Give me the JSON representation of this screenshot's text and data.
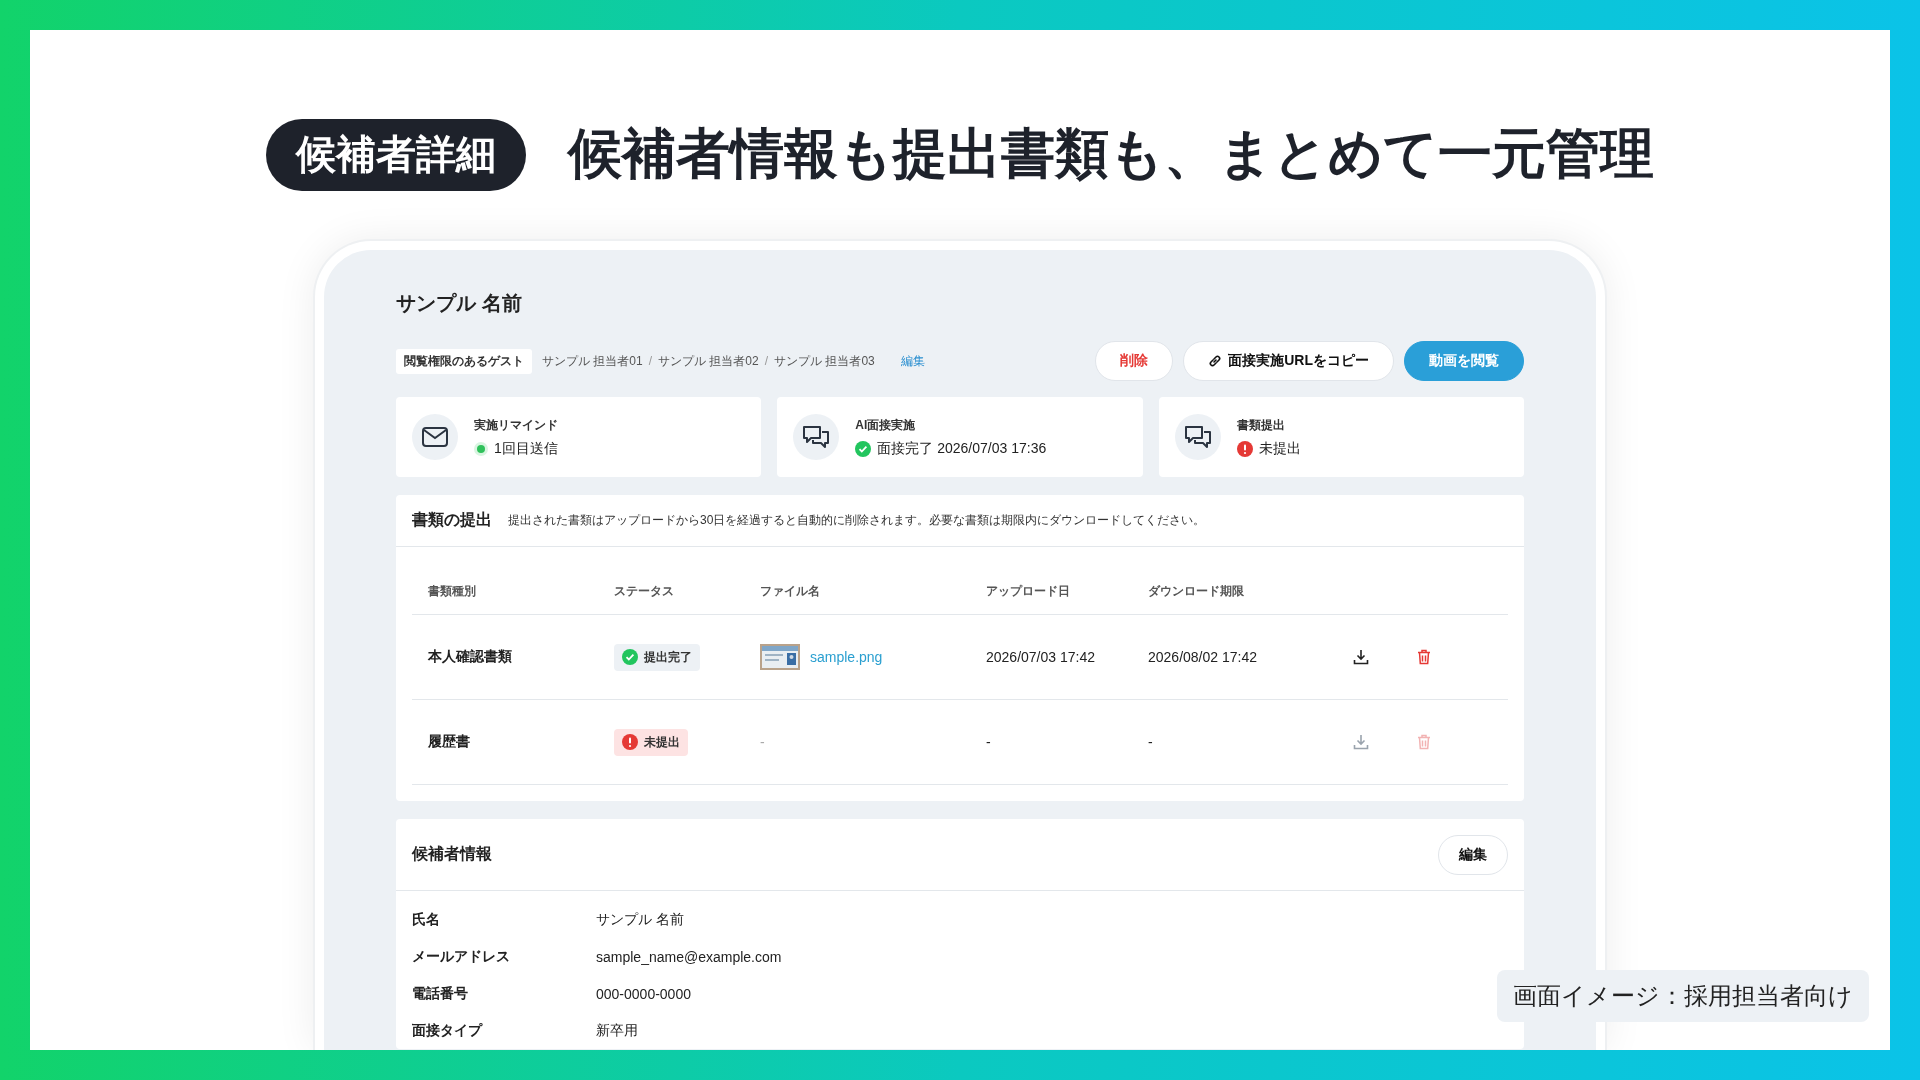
{
  "headline": {
    "badge": "候補者詳細",
    "title": "候補者情報も提出書類も、まとめて一元管理"
  },
  "screen": {
    "candidate_name": "サンプル 名前",
    "guests": {
      "label": "閲覧権限のあるゲスト",
      "separator": "/",
      "names": [
        "サンプル 担当者01",
        "サンプル 担当者02",
        "サンプル 担当者03"
      ],
      "edit_link": "編集"
    },
    "actions": [
      {
        "label": "削除",
        "kind": "danger"
      },
      {
        "label": "面接実施URLをコピー",
        "kind": "copy"
      },
      {
        "label": "動画を閲覧",
        "kind": "primary"
      }
    ],
    "status_cards": [
      {
        "label": "実施リマインド",
        "value": "1回目送信",
        "kind": "sent"
      },
      {
        "label": "AI面接実施",
        "value": "面接完了 2026/07/03 17:36",
        "kind": "complete"
      },
      {
        "label": "書類提出",
        "value": "未提出",
        "kind": "missing"
      }
    ]
  },
  "documents": {
    "title": "書類の提出",
    "note": "提出された書類はアップロードから30日を経過すると自動的に削除されます。必要な書類は期限内にダウンロードしてください。",
    "columns": [
      "書類種別",
      "ステータス",
      "ファイル名",
      "アップロード日",
      "ダウンロード期限"
    ],
    "rows": [
      {
        "type": "本人確認書類",
        "status": {
          "label": "提出完了",
          "kind": "complete"
        },
        "file": {
          "kind": "picture",
          "name": "sample.png"
        },
        "uploaded": "2026/07/03 17:42",
        "deadline": "2026/08/02 17:42",
        "disabled": false
      },
      {
        "type": "履歴書",
        "status": {
          "label": "未提出",
          "kind": "missing"
        },
        "file": {
          "name": "-"
        },
        "uploaded": "-",
        "deadline": "-",
        "disabled": true
      }
    ]
  },
  "candidate_info": {
    "title": "候補者情報",
    "edit_button": "編集",
    "fields": [
      {
        "label": "氏名",
        "value": "サンプル 名前"
      },
      {
        "label": "メールアドレス",
        "value": "sample_name@example.com"
      },
      {
        "label": "電話番号",
        "value": "000-0000-0000"
      },
      {
        "label": "面接タイプ",
        "value": "新卒用"
      }
    ]
  },
  "caption": "画面イメージ：採用担当者向け"
}
